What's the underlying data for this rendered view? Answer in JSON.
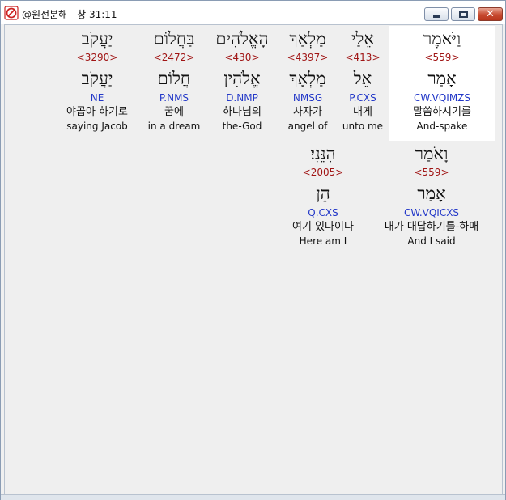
{
  "window": {
    "title": "@원전분해 - 창 31:11",
    "icon": "no-symbol-icon",
    "close_glyph": "✕"
  },
  "words": [
    {
      "hebrew": "וַיֹּאמֶר",
      "strong": "<559>",
      "lemma": "אָמַר",
      "parse": "CW.VQIMZS",
      "korean": "말씀하시기를",
      "english": "And-spake",
      "selected": true
    },
    {
      "hebrew": "אֵלַי",
      "strong": "<413>",
      "lemma": "אֵל",
      "parse": "P.CXS",
      "korean": "내게",
      "english": "unto me"
    },
    {
      "hebrew": "מַלְאַךְ",
      "strong": "<4397>",
      "lemma": "מַלְאָךְ",
      "parse": "NMSG",
      "korean": "사자가",
      "english": "angel of"
    },
    {
      "hebrew": "הָאֱלֹהִים",
      "strong": "<430>",
      "lemma": "אֱלֹהִין",
      "parse": "D.NMP",
      "korean": "하나님의",
      "english": "the-God"
    },
    {
      "hebrew": "בַּחֲלוֹם",
      "strong": "<2472>",
      "lemma": "חֲלוֹם",
      "parse": "P.NMS",
      "korean": "꿈에",
      "english": "in a dream"
    },
    {
      "hebrew": "יַעֲקֹב",
      "strong": "<3290>",
      "lemma": "יַעֲקֹב",
      "parse": "NE",
      "korean": "야곱아 하기로",
      "english": "saying Jacob"
    },
    {
      "hebrew": "וָאֹמַר",
      "strong": "<559>",
      "lemma": "אָמַר",
      "parse": "CW.VQICXS",
      "korean": "내가 대답하기를-하매",
      "english": "And I said"
    },
    {
      "hebrew": "הִנֵּנִי׃",
      "strong": "<2005>",
      "lemma": "הֵן",
      "parse": "Q.CXS",
      "korean": "여기 있나이다",
      "english": "Here am I"
    }
  ]
}
